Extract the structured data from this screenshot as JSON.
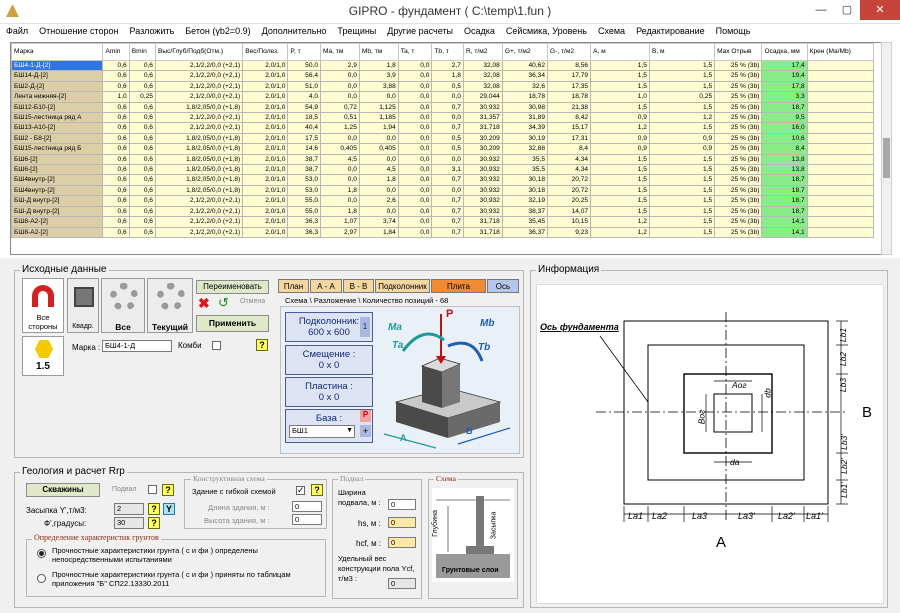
{
  "window": {
    "title": "GIPRO - фундамент ( C:\\temp\\1.fun )",
    "min": "—",
    "max": "▢",
    "close": "✕"
  },
  "menu": [
    "Файл",
    "Отношение сторон",
    "Разложить",
    "Бетон (γb2=0.9)",
    "Дополнительно",
    "Трещины",
    "Другие расчеты",
    "Осадка",
    "Сейсмика, Уровень",
    "Схема",
    "Редактирование",
    "Помощь"
  ],
  "table": {
    "headers": [
      "Марка",
      "Amin",
      "Bmin",
      "Выс/Глуб/Подб(Отм.)",
      "Вес/Полез.",
      "P, т",
      "Ma, тм",
      "Mb, тм",
      "Ta, т",
      "Tb, т",
      "R, т/м2",
      "G+, т/м2",
      "G-, т/м2",
      "A, м",
      "B, м",
      "Max Отрыв",
      "Осадка, мм",
      "Крен (Ma/Mb)"
    ],
    "rows": [
      [
        "БШ4-1-Д-[2]",
        "0,6",
        "0,6",
        "2,1/2,2/0,0 (+2,1)",
        "2,0/1,0",
        "50,0",
        "2,9",
        "1,8",
        "0,0",
        "2,7",
        "32,08",
        "40,62",
        "8,56",
        "1,5",
        "1,5",
        "25 % (3b)",
        "17,4",
        ""
      ],
      [
        "БШ14-Д-[2]",
        "0,6",
        "0,6",
        "2,1/2,2/0,0 (+2,1)",
        "2,0/1,0",
        "56,4",
        "0,0",
        "3,9",
        "0,0",
        "1,8",
        "32,08",
        "36,34",
        "17,79",
        "1,5",
        "1,5",
        "25 % (3b)",
        "19,4",
        ""
      ],
      [
        "БШ2-Д-[2]",
        "0,6",
        "0,6",
        "2,1/2,2/0,0 (+2,1)",
        "2,0/1,0",
        "51,0",
        "0,0",
        "3,88",
        "0,0",
        "0,5",
        "32,08",
        "32,6",
        "17,35",
        "1,5",
        "1,5",
        "25 % (3b)",
        "17,8",
        ""
      ],
      [
        "Лента нижняя-[2]",
        "1,0",
        "0,25",
        "2,1/2,0/0,0 (+2,1)",
        "2,0/1,0",
        "4,0",
        "0,0",
        "0,0",
        "0,0",
        "0,0",
        "29,044",
        "18,78",
        "18,78",
        "1,0",
        "0,25",
        "25 % (3b)",
        "3,3",
        ""
      ],
      [
        "БШ12-Б10-[2]",
        "0,6",
        "0,6",
        "1,8/2,05/0,0 (+1,8)",
        "2,0/1,0",
        "54,9",
        "0,72",
        "1,125",
        "0,0",
        "0,7",
        "30,932",
        "30,98",
        "21,38",
        "1,5",
        "1,5",
        "25 % (3b)",
        "18,7",
        ""
      ],
      [
        "БШ15-лестница ряд А",
        "0,6",
        "0,6",
        "2,1/2,2/0,0 (+2,1)",
        "2,0/1,0",
        "18,5",
        "0,51",
        "1,185",
        "0,0",
        "0,0",
        "31,357",
        "31,89",
        "8,42",
        "0,9",
        "1,2",
        "25 % (3b)",
        "9,5",
        ""
      ],
      [
        "БШ13-А10-[2]",
        "0,6",
        "0,6",
        "2,1/2,2/0,0 (+2,1)",
        "2,0/1,0",
        "40,4",
        "1,25",
        "1,94",
        "0,0",
        "0,7",
        "31,718",
        "34,39",
        "15,17",
        "1,2",
        "1,5",
        "25 % (3b)",
        "16,0",
        ""
      ],
      [
        "БШ2 - Б8-[2]",
        "0,6",
        "0,6",
        "1,8/2,05/0,0 (+1,8)",
        "2,0/1,0",
        "17,5",
        "0,0",
        "0,0",
        "0,0",
        "0,5",
        "30,209",
        "30,19",
        "17,31",
        "0,9",
        "0,9",
        "25 % (3b)",
        "10,6",
        ""
      ],
      [
        "БШ15-лестница ряд Б",
        "0,6",
        "0,6",
        "1,8/2,05/0,0 (+1,8)",
        "2,0/1,0",
        "14,6",
        "0,405",
        "0,405",
        "0,0",
        "0,5",
        "30,209",
        "32,88",
        "8,4",
        "0,9",
        "0,9",
        "25 % (3b)",
        "8,4",
        ""
      ],
      [
        "БШ6-[2]",
        "0,6",
        "0,6",
        "1,8/2,05/0,0 (+1,8)",
        "2,0/1,0",
        "38,7",
        "4,5",
        "0,0",
        "0,0",
        "0,0",
        "30,932",
        "35,5",
        "4,34",
        "1,5",
        "1,5",
        "25 % (3b)",
        "13,8",
        ""
      ],
      [
        "БШ6-[2]",
        "0,6",
        "0,6",
        "1,8/2,05/0,0 (+1,8)",
        "2,0/1,0",
        "38,7",
        "0,0",
        "4,5",
        "0,0",
        "3,1",
        "30,932",
        "35,5",
        "4,34",
        "1,5",
        "1,5",
        "25 % (3b)",
        "13,8",
        ""
      ],
      [
        "БШ4внутр-[2]",
        "0,6",
        "0,6",
        "1,8/2,05/0,0 (+1,8)",
        "2,0/1,0",
        "53,0",
        "0,0",
        "1,8",
        "0,0",
        "0,7",
        "30,932",
        "30,18",
        "20,72",
        "1,5",
        "1,5",
        "25 % (3b)",
        "18,7",
        ""
      ],
      [
        "БШ4внутр-[2]",
        "0,6",
        "0,6",
        "1,8/2,05/0,0 (+1,8)",
        "2,0/1,0",
        "53,0",
        "1,8",
        "0,0",
        "0,0",
        "0,0",
        "30,932",
        "30,18",
        "20,72",
        "1,5",
        "1,5",
        "25 % (3b)",
        "18,7",
        ""
      ],
      [
        "БШ-Д внутр-[2]",
        "0,6",
        "0,6",
        "2,1/2,2/0,0 (+2,1)",
        "2,0/1,0",
        "55,0",
        "0,0",
        "2,6",
        "0,0",
        "0,7",
        "30,932",
        "32,19",
        "20,25",
        "1,5",
        "1,5",
        "25 % (3b)",
        "18,7",
        ""
      ],
      [
        "БШ-Д внутр-[2]",
        "0,6",
        "0,6",
        "2,1/2,2/0,0 (+2,1)",
        "2,0/1,0",
        "55,0",
        "1,8",
        "0,0",
        "0,0",
        "0,7",
        "30,932",
        "38,37",
        "14,07",
        "1,5",
        "1,5",
        "25 % (3b)",
        "18,7",
        ""
      ],
      [
        "БШ8-А2-[2]",
        "0,6",
        "0,6",
        "2,1/2,2/0,0 (+2,1)",
        "2,0/1,0",
        "36,3",
        "1,07",
        "3,74",
        "0,0",
        "0,7",
        "31,718",
        "35,45",
        "10,15",
        "1,2",
        "1,5",
        "25 % (3b)",
        "14,1",
        ""
      ],
      [
        "БШ8-А2-[2]",
        "0,6",
        "0,6",
        "2,1/2,2/0,0 (+2,1)",
        "2,0/1,0",
        "36,3",
        "2,97",
        "1,84",
        "0,0",
        "0,7",
        "31,718",
        "36,37",
        "9,23",
        "1,2",
        "1,5",
        "25 % (3b)",
        "14,1",
        ""
      ]
    ]
  },
  "source": {
    "title": "Исходные данные",
    "all_sides": "Все стороны",
    "kvadr": "Квадр.",
    "all": "Все",
    "current": "Текущий",
    "rename": "Переименовать",
    "cancel": "Отмена",
    "apply": "Применить",
    "ratio": "1.5",
    "mark_label": "Марка :",
    "mark_value": "БШ4-1-Д",
    "combi": "Комби",
    "q": "?"
  },
  "tabs": [
    "План",
    "А - А",
    "В - В",
    "Подколонник",
    "Плита",
    "Ось"
  ],
  "scheme": {
    "title": "Схема \\ Разложение \\ Количество позиций -  68",
    "podkol_label": "Подколонник:",
    "podkol_value": "600 x 600",
    "podkol_n": "1",
    "shift_label": "Смещение :",
    "shift_value": "0 x 0",
    "plate_label": "Пластина :",
    "plate_value": "0 x 0",
    "base_label": "База :",
    "base_value": "БШ1",
    "base_p": "P",
    "base_plus": "+",
    "fig_p": "P",
    "fig_ma": "Ma",
    "fig_ta": "Ta",
    "fig_mb": "Mb",
    "fig_tb": "Tb",
    "fig_a": "A",
    "fig_b": "B"
  },
  "info": {
    "title": "Информация",
    "axis": "Ось фундамента",
    "la1": "La1",
    "la2": "La2",
    "la3": "La3",
    "la3p": "La3'",
    "la2p": "La2'",
    "la1p": "La1'",
    "lb1": "Lb1",
    "lb2": "Lb2",
    "lb3": "Lb3",
    "lb3p": "Lb3'",
    "lb2p": "Lb2'",
    "lb1p": "Lb1'",
    "aog": "Aог",
    "bog": "Bог",
    "da": "da",
    "db": "db",
    "A": "A",
    "B": "B"
  },
  "geo": {
    "title": "Геология и расчет Rrp",
    "wells": "Скважины",
    "podval": "Подвал",
    "zasypka": "Засыпка Y',т/м3:",
    "zasypka_val": "2",
    "phi": "Ф',градусы:",
    "phi_val": "30",
    "q": "?",
    "y": "Y",
    "konstr_title": "Конструктивная схема",
    "flex": "Здание с гибкой схемой",
    "length": "Длина здания, м :",
    "length_val": "0",
    "height": "Высота здания, м :",
    "height_val": "0",
    "char_title": "Определение характеристик грунтов",
    "radio1": "Прочностные характеристики грунта ( c и фи ) определены непосредственными испытаниями",
    "radio2": "Прочностные характеристики грунта ( c и фи ) приняты по таблицам приложения \"Б\" СП22.13330.2011",
    "basement_title": "Подвал",
    "bw": "Ширина подвала, м :",
    "bw_val": "0",
    "hs": "hs, м :",
    "hs_val": "0",
    "hcf": "hcf, м :",
    "hcf_val": "0",
    "ycf": "Удельный вес конструкции пола Ycf, т/м3 :",
    "ycf_val": "0",
    "schema_title": "Схема",
    "glubina": "Глубина",
    "zasypka_v": "Засыпка",
    "grunt": "Грунтовые слои"
  }
}
